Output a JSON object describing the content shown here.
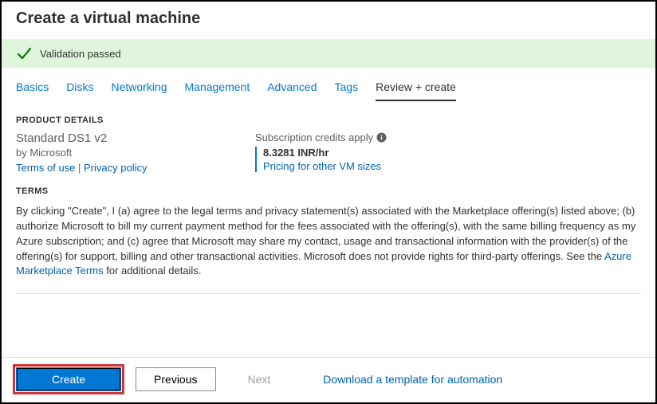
{
  "header": {
    "title": "Create a virtual machine"
  },
  "validation": {
    "message": "Validation passed"
  },
  "tabs": {
    "t0": "Basics",
    "t1": "Disks",
    "t2": "Networking",
    "t3": "Management",
    "t4": "Advanced",
    "t5": "Tags",
    "t6": "Review + create"
  },
  "product": {
    "section_label": "PRODUCT DETAILS",
    "name": "Standard DS1 v2",
    "by": "by Microsoft",
    "terms_link": "Terms of use",
    "sep": " | ",
    "privacy_link": "Privacy policy",
    "credits_line": "Subscription credits apply",
    "price": "8.3281 INR/hr",
    "pricing_link": "Pricing for other VM sizes"
  },
  "terms": {
    "section_label": "TERMS",
    "body_a": "By clicking \"Create\", I (a) agree to the legal terms and privacy statement(s) associated with the Marketplace offering(s) listed above; (b) authorize Microsoft to bill my current payment method for the fees associated with the offering(s), with the same billing frequency as my Azure subscription; and (c) agree that Microsoft may share my contact, usage and transactional information with the provider(s) of the offering(s) for support, billing and other transactional activities. Microsoft does not provide rights for third-party offerings. See the ",
    "link": "Azure Marketplace Terms",
    "body_b": " for additional details."
  },
  "footer": {
    "create": "Create",
    "previous": "Previous",
    "next": "Next",
    "download": "Download a template for automation"
  }
}
